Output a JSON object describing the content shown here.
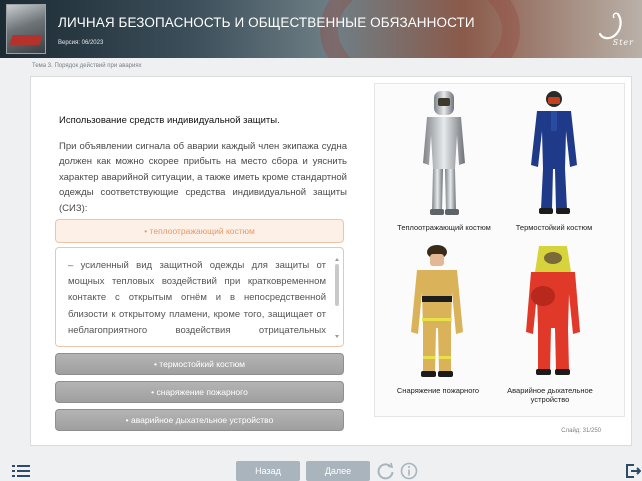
{
  "header": {
    "title": "ЛИЧНАЯ БЕЗОПАСНОСТЬ И ОБЩЕСТВЕННЫЕ ОБЯЗАННОСТИ",
    "version": "Версия: 06/2023",
    "logo_text": "Ster"
  },
  "breadcrumb": "Тема 3. Порядок действий при авариях",
  "content": {
    "section_title": "Использование средств индивидуальной защиты.",
    "intro": "При объявлении сигнала об аварии каждый член экипажа судна должен как можно скорее прибыть на место сбора и уяснить характер аварийной ситуации, а также иметь кроме стандартной одежды соответствующие средства индивидуальной защиты (СИЗ):",
    "active_item": "• теплоотражающий костюм",
    "active_text": "– усиленный вид защитной одежды для защиты от мощных тепловых воздействий при кратковременном контакте с открытым огнём и в непосредственной близости к открытому пламени, кроме того, защищает от неблагоприятного воздействия отрицательных температур",
    "items": [
      "• термостойкий костюм",
      "• снаряжение пожарного",
      "• аварийное дыхательное устройство"
    ]
  },
  "images": [
    {
      "label": "Теплоотражающий костюм",
      "icon": "heat-reflective-suit-icon"
    },
    {
      "label": "Термостойкий костюм",
      "icon": "heat-resistant-suit-icon"
    },
    {
      "label": "Снаряжение пожарного",
      "icon": "firefighter-outfit-icon"
    },
    {
      "label": "Аварийное дыхательное устройство",
      "icon": "emergency-breathing-device-icon"
    }
  ],
  "slide_counter": "Слайд: 31/250",
  "navigation": {
    "back": "Назад",
    "next": "Далее"
  },
  "colors": {
    "accent": "#e39a6c",
    "nav_button": "#a9b4bd",
    "inactive_item": "#a8a8a8"
  }
}
